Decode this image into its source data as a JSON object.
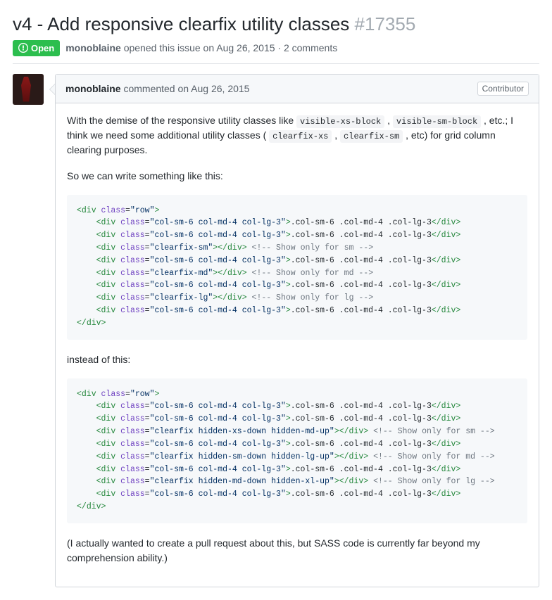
{
  "issue": {
    "title": "v4 - Add responsive clearfix utility classes",
    "number": "#17355",
    "state": "Open",
    "author": "monoblaine",
    "metaText": "opened this issue on Aug 26, 2015 · 2 comments"
  },
  "comment": {
    "author": "monoblaine",
    "action": "commented on Aug 26, 2015",
    "badge": "Contributor",
    "para1_a": "With the demise of the responsive utility classes like ",
    "code1": "visible-xs-block",
    "sep1": " , ",
    "code2": "visible-sm-block",
    "para1_b": " , etc.; I think we need some additional utility classes ( ",
    "code3": "clearfix-xs",
    "sep2": " , ",
    "code4": "clearfix-sm",
    "para1_c": " , etc) for grid column clearing purposes.",
    "para2": "So we can write something like this:",
    "para3": "instead of this:",
    "para4": "(I actually wanted to create a pull request about this, but SASS code is currently far beyond my comprehension ability.)"
  },
  "code": {
    "colClasses": "col-sm-6 col-md-4 col-lg-3",
    "colText": ".col-sm-6 .col-md-4 .col-lg-3",
    "row": "row",
    "cf_sm": "clearfix-sm",
    "cf_md": "clearfix-md",
    "cf_lg": "clearfix-lg",
    "cf_sm_long": "clearfix hidden-xs-down hidden-md-up",
    "cf_md_long": "clearfix hidden-sm-down hidden-lg-up",
    "cf_lg_long": "clearfix hidden-md-down hidden-xl-up",
    "cmt_sm": " Show only for sm ",
    "cmt_md": " Show only for md ",
    "cmt_lg": " Show only for lg "
  }
}
